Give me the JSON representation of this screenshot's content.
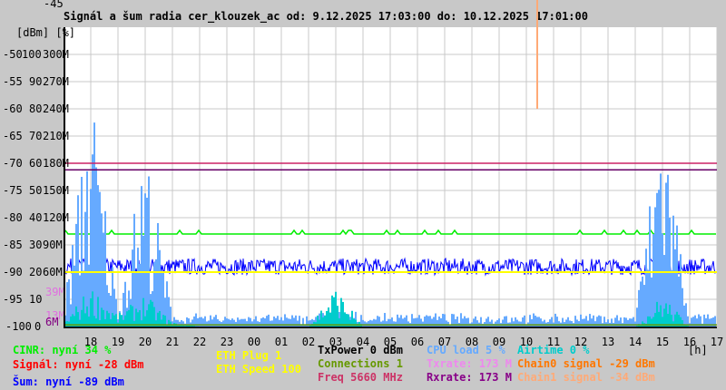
{
  "chart_data": {
    "type": "line",
    "title": "Signál a šum radia cer_klouzek_ac od: 9.12.2025 17:03:00 do: 10.12.2025 17:01:00",
    "xlabel": "[h]",
    "ylabel": "[dBm] [%]",
    "x_ticks": [
      "18",
      "19",
      "20",
      "21",
      "22",
      "23",
      "00",
      "01",
      "02",
      "03",
      "04",
      "05",
      "06",
      "07",
      "08",
      "09",
      "10",
      "11",
      "12",
      "13",
      "14",
      "15",
      "16",
      "17"
    ],
    "y_ticks_dbm": [
      "-45",
      "-50",
      "-55",
      "-60",
      "-65",
      "-70",
      "-75",
      "-80",
      "-85",
      "-90",
      "-95",
      "-100"
    ],
    "y_ticks_pct": [
      "100",
      "90",
      "80",
      "70",
      "60",
      "50",
      "40",
      "30",
      "20",
      "10",
      "0"
    ],
    "y_ticks_rate": [
      "300M",
      "270M",
      "240M",
      "210M",
      "180M",
      "150M",
      "120M",
      "90M",
      "60M"
    ],
    "rate_marks": [
      {
        "label": "39M",
        "color": "#e070e0"
      },
      {
        "label": "13M",
        "color": "#e070e0"
      },
      {
        "label": "6M",
        "color": "#800080"
      }
    ],
    "ylim": [
      -100,
      -45
    ],
    "xlim_hours": [
      17,
      41
    ],
    "grid": true,
    "hourly_x": [
      17,
      18,
      19,
      20,
      21,
      22,
      23,
      24,
      25,
      26,
      27,
      28,
      29,
      30,
      31,
      32,
      33,
      34,
      35,
      36,
      37,
      38,
      39,
      40,
      41
    ],
    "series": [
      {
        "name": "CINR %",
        "color": "#00ee00",
        "values": [
          34,
          34,
          34,
          34,
          34,
          34,
          34,
          34,
          34,
          34,
          34,
          34,
          34,
          34,
          34,
          34,
          34,
          34,
          34,
          34,
          34,
          34,
          34,
          34,
          34
        ]
      },
      {
        "name": "Šum dBm",
        "color": "#0000ff",
        "values": [
          -89,
          -89,
          -89,
          -89,
          -89,
          -89,
          -89,
          -89,
          -89,
          -89,
          -89,
          -89,
          -89,
          -89,
          -89,
          -89,
          -89,
          -89,
          -89,
          -89,
          -89,
          -89,
          -89,
          -89,
          -89
        ]
      },
      {
        "name": "CPU load %",
        "color": "#66aaff",
        "values": [
          3,
          60,
          4,
          45,
          2,
          2,
          2,
          2,
          2,
          2,
          4,
          2,
          2,
          3,
          2,
          2,
          2,
          2,
          2,
          2,
          2,
          2,
          55,
          2,
          2
        ]
      },
      {
        "name": "Airtime %",
        "color": "#00cccc",
        "values": [
          1,
          10,
          3,
          8,
          1,
          0,
          0,
          0,
          0,
          0,
          10,
          0,
          0,
          0,
          0,
          0,
          0,
          0,
          0,
          0,
          0,
          0,
          8,
          0,
          0
        ]
      },
      {
        "name": "Signál ref",
        "color": "#cc2266",
        "values": [
          -70,
          -70,
          -70,
          -70,
          -70,
          -70,
          -70,
          -70,
          -70,
          -70,
          -70,
          -70,
          -70,
          -70,
          -70,
          -70,
          -70,
          -70,
          -70,
          -70,
          -70,
          -70,
          -70,
          -70,
          -70
        ]
      },
      {
        "name": "Rxrate ref",
        "color": "#660066",
        "values": [
          -71.2,
          -71.2,
          -71.2,
          -71.2,
          -71.2,
          -71.2,
          -71.2,
          -71.2,
          -71.2,
          -71.2,
          -71.2,
          -71.2,
          -71.2,
          -71.2,
          -71.2,
          -71.2,
          -71.2,
          -71.2,
          -71.2,
          -71.2,
          -71.2,
          -71.2,
          -71.2,
          -71.2,
          -71.2
        ]
      },
      {
        "name": "ETH Speed",
        "color": "#ffff00",
        "values": [
          -90,
          -90,
          -90,
          -90,
          -90,
          -90,
          -90,
          -90,
          -90,
          -90,
          -90,
          -90,
          -90,
          -90,
          -90,
          -90,
          -90,
          -90,
          -90,
          -90,
          -90,
          -90,
          -90,
          -90,
          -90
        ]
      },
      {
        "name": "Connections",
        "color": "#669900",
        "values": [
          -99.7,
          -99.7,
          -99.7,
          -99.7,
          -99.7,
          -99.7,
          -99.7,
          -99.7,
          -99.7,
          -99.7,
          -99.7,
          -99.7,
          -99.7,
          -99.7,
          -99.7,
          -99.7,
          -99.7,
          -99.7,
          -99.7,
          -99.7,
          -99.7,
          -99.7,
          -99.7,
          -99.7,
          -99.7
        ]
      }
    ],
    "chain1_spike": {
      "hour": 34.4,
      "top": -45,
      "bottom": -60,
      "color": "#ffaa77"
    }
  },
  "legend": [
    {
      "text": "CINR: nyní 34 %",
      "color": "#00ee00"
    },
    {
      "text": "Signál: nyní -28 dBm",
      "color": "#ff0000"
    },
    {
      "text": "Šum: nyní -89 dBm",
      "color": "#0000ff"
    },
    {
      "text": "ETH Plug 1",
      "color": "#ffff00"
    },
    {
      "text": "ETH Speed 100",
      "color": "#ffff00"
    },
    {
      "text": "TxPower 0 dBm",
      "color": "#000000"
    },
    {
      "text": "Connections 1",
      "color": "#669900"
    },
    {
      "text": "Freq 5660 MHz",
      "color": "#cc3366"
    },
    {
      "text": "CPU load 5 %",
      "color": "#66aaff"
    },
    {
      "text": "Txrate: 173 M",
      "color": "#ee88ee"
    },
    {
      "text": "Rxrate: 173 M",
      "color": "#880088"
    },
    {
      "text": "Airtime 0 %",
      "color": "#00cccc"
    },
    {
      "text": "Chain0 signal -29 dBm",
      "color": "#ff7700"
    },
    {
      "text": "Chain1 signal -34 dBm",
      "color": "#ffaa77"
    }
  ]
}
